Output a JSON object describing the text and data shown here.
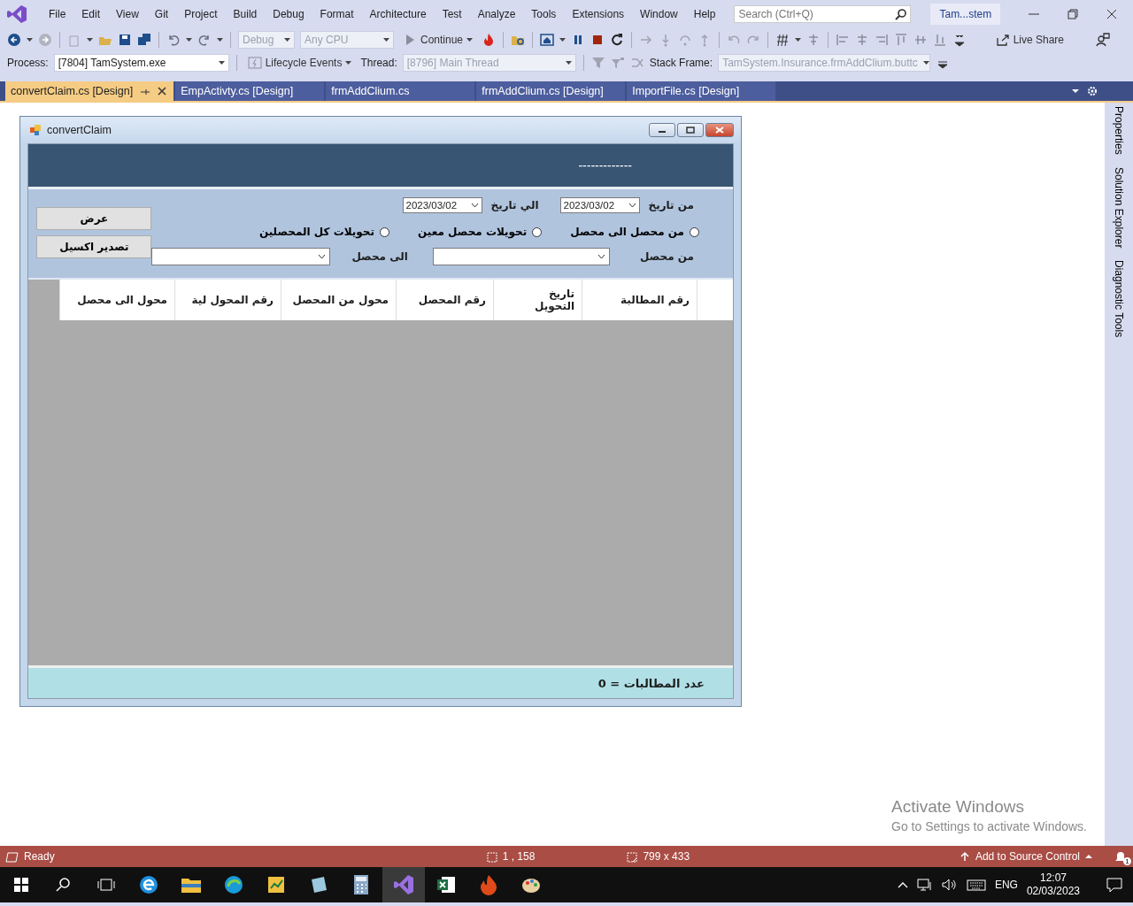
{
  "menu_bar": {
    "items": [
      "File",
      "Edit",
      "View",
      "Git",
      "Project",
      "Build",
      "Debug",
      "Format",
      "Architecture",
      "Test",
      "Analyze",
      "Tools",
      "Extensions",
      "Window",
      "Help"
    ],
    "search": {
      "placeholder": "Search (Ctrl+Q)"
    },
    "solution_badge": "Tam...stem"
  },
  "toolbar": {
    "configuration": {
      "value": "Debug",
      "disabled": true
    },
    "platform": {
      "value": "Any CPU",
      "disabled": true
    },
    "continue": "Continue",
    "live_share": "Live Share"
  },
  "debug_location": {
    "process_label": "Process:",
    "process": "[7804] TamSystem.exe",
    "lifecycle": "Lifecycle Events",
    "thread_label": "Thread:",
    "thread": {
      "value": "[8796] Main Thread",
      "disabled": true
    },
    "stack_frame_label": "Stack Frame:",
    "stack_frame": {
      "value": "TamSystem.Insurance.frmAddClium.buttc",
      "disabled": true
    }
  },
  "tabs": [
    {
      "label": "convertClaim.cs [Design]",
      "selected": true
    },
    {
      "label": "EmpActivty.cs [Design]",
      "selected": false
    },
    {
      "label": "frmAddClium.cs",
      "selected": false
    },
    {
      "label": "frmAddClium.cs [Design]",
      "selected": false
    },
    {
      "label": "ImportFile.cs [Design]",
      "selected": false
    }
  ],
  "side_panels": [
    "Properties",
    "Solution Explorer",
    "Diagnostic Tools"
  ],
  "form": {
    "title": "convertClaim",
    "header_text": "-------------",
    "from_date_label": "من تاريخ",
    "from_date": "2023/03/02",
    "to_date_label": "الي تاريخ",
    "to_date": "2023/03/02",
    "options": [
      {
        "label": "من محصل الى محصل",
        "selected": false
      },
      {
        "label": "تحويلات محصل معين",
        "selected": false
      },
      {
        "label": "تحويلات كل المحصلين",
        "selected": false
      }
    ],
    "from_collector_label": "من محصل",
    "to_collector_label": "الى محصل",
    "buttons": [
      "عرض",
      "تصدير اكسيل"
    ],
    "grid": {
      "columns": [
        "رقم المطالبة",
        "تاريخ التحويل",
        "رقم المحصل",
        "محول من المحصل",
        "رقم المحول لية",
        "محول الى محصل"
      ]
    },
    "footer": "عدد المطالبات = 0"
  },
  "activation": {
    "title": "Activate Windows",
    "message": "Go to Settings to activate Windows."
  },
  "status_bar": {
    "state": "Ready",
    "position": "1 , 158",
    "size": "799 x 433",
    "source_control": "Add to Source Control",
    "notifications": "1"
  },
  "taskbar": {
    "language": "ENG",
    "time": "12:07",
    "date": "02/03/2023"
  }
}
